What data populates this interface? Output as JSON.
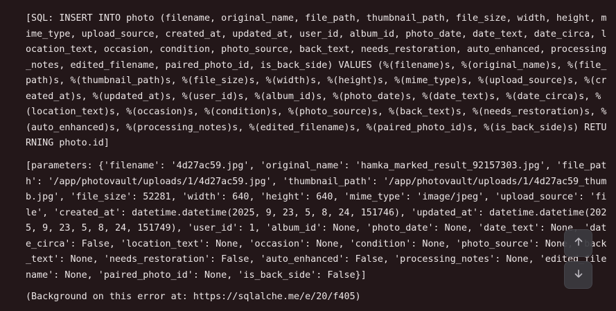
{
  "error": {
    "sql": "[SQL: INSERT INTO photo (filename, original_name, file_path, thumbnail_path, file_size, width, height, mime_type, upload_source, created_at, updated_at, user_id, album_id, photo_date, date_text, date_circa, location_text, occasion, condition, photo_source, back_text, needs_restoration, auto_enhanced, processing_notes, edited_filename, paired_photo_id, is_back_side) VALUES (%(filename)s, %(original_name)s, %(file_path)s, %(thumbnail_path)s, %(file_size)s, %(width)s, %(height)s, %(mime_type)s, %(upload_source)s, %(created_at)s, %(updated_at)s, %(user_id)s, %(album_id)s, %(photo_date)s, %(date_text)s, %(date_circa)s, %(location_text)s, %(occasion)s, %(condition)s, %(photo_source)s, %(back_text)s, %(needs_restoration)s, %(auto_enhanced)s, %(processing_notes)s, %(edited_filename)s, %(paired_photo_id)s, %(is_back_side)s) RETURNING photo.id]",
    "parameters": "[parameters: {'filename': '4d27ac59.jpg', 'original_name': 'hamka_marked_result_92157303.jpg', 'file_path': '/app/photovault/uploads/1/4d27ac59.jpg', 'thumbnail_path': '/app/photovault/uploads/1/4d27ac59_thumb.jpg', 'file_size': 52281, 'width': 640, 'height': 640, 'mime_type': 'image/jpeg', 'upload_source': 'file', 'created_at': datetime.datetime(2025, 9, 23, 5, 8, 24, 151746), 'updated_at': datetime.datetime(2025, 9, 23, 5, 8, 24, 151749), 'user_id': 1, 'album_id': None, 'photo_date': None, 'date_text': None, 'date_circa': False, 'location_text': None, 'occasion': None, 'condition': None, 'photo_source': None, 'back_text': None, 'needs_restoration': False, 'auto_enhanced': False, 'processing_notes': None, 'edited_filename': None, 'paired_photo_id': None, 'is_back_side': False}]",
    "background": "(Background on this error at: https://sqlalche.me/e/20/f405)"
  },
  "controls": {
    "scroll_up_icon": "arrow-up-icon",
    "scroll_down_icon": "arrow-down-icon"
  },
  "colors": {
    "background": "#231719",
    "text": "#ece6e6",
    "button_bg": "#3b3a40",
    "button_icon": "#c9c7ce"
  }
}
